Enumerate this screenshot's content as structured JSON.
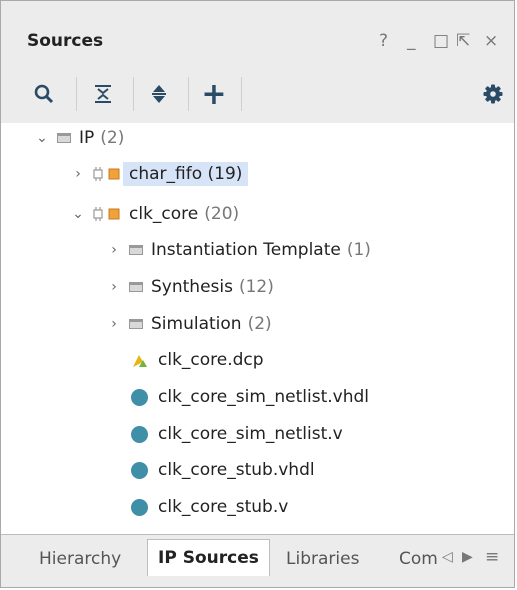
{
  "panel": {
    "title": "Sources"
  },
  "window_controls": {
    "help": "?",
    "minimize": "_",
    "maximize": "□",
    "float": "⇱",
    "close": "×"
  },
  "toolbar": {
    "icons": [
      "search-icon",
      "collapse-all-icon",
      "expand-all-icon",
      "add-icon",
      "gear-icon"
    ],
    "add_symbol": "+"
  },
  "tree": {
    "root": {
      "label": "IP",
      "count": "(2)"
    },
    "char_fifo": {
      "label": "char_fifo",
      "count": "(19)"
    },
    "clk_core": {
      "label": "clk_core",
      "count": "(20)"
    },
    "folders": [
      {
        "label": "Instantiation Template",
        "count": "(1)"
      },
      {
        "label": "Synthesis",
        "count": "(12)"
      },
      {
        "label": "Simulation",
        "count": "(2)"
      }
    ],
    "files": [
      {
        "label": "clk_core.dcp",
        "icon": "dcp-icon"
      },
      {
        "label": "clk_core_sim_netlist.vhdl",
        "icon": "file-dot-icon"
      },
      {
        "label": "clk_core_sim_netlist.v",
        "icon": "file-dot-icon"
      },
      {
        "label": "clk_core_stub.vhdl",
        "icon": "file-dot-icon"
      },
      {
        "label": "clk_core_stub.v",
        "icon": "file-dot-icon"
      }
    ]
  },
  "tabs": [
    {
      "label": "Hierarchy",
      "active": false
    },
    {
      "label": "IP Sources",
      "active": true
    },
    {
      "label": "Libraries",
      "active": false
    },
    {
      "label": "Com",
      "active": false
    }
  ],
  "colors": {
    "file_dot": "#3e8fa7",
    "selected_bg": "#d7e4f7",
    "ip_orange": "#f0a13a"
  }
}
